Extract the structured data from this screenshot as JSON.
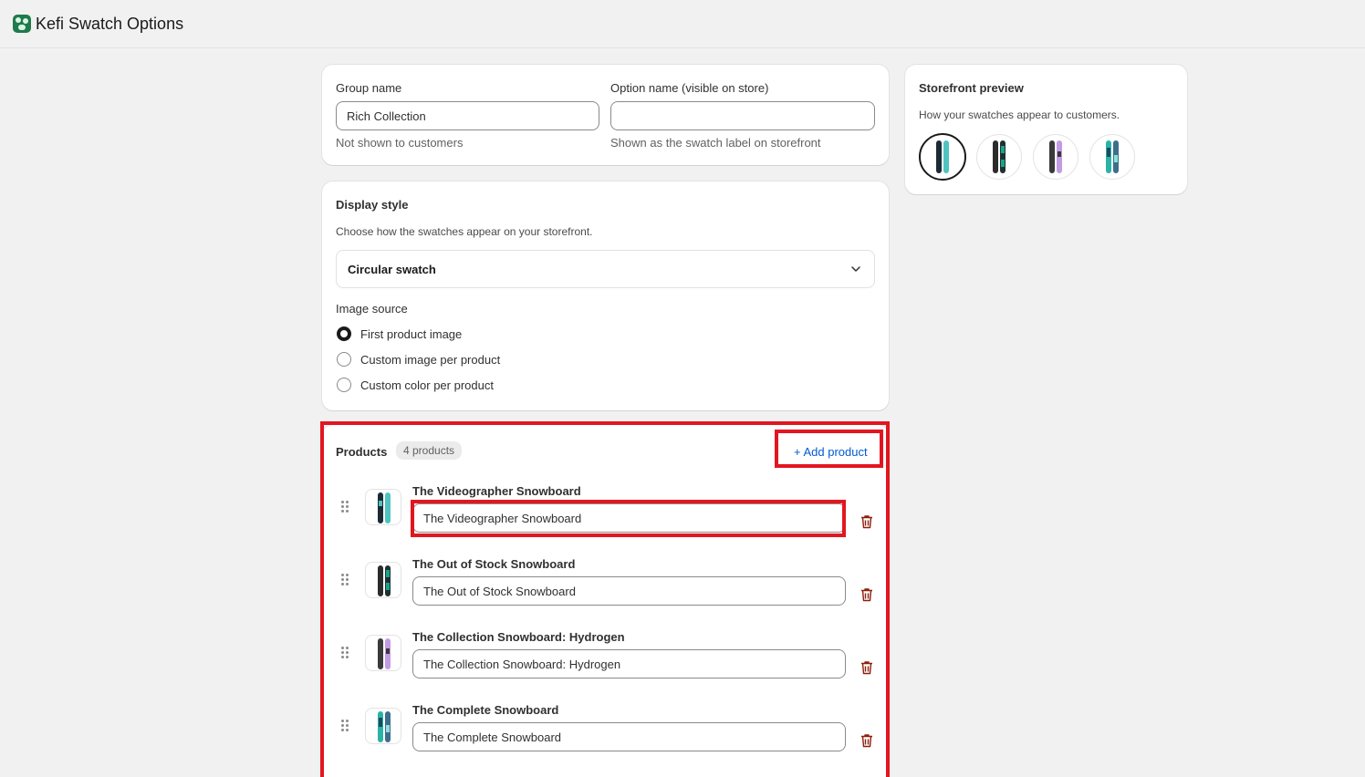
{
  "app": {
    "title": "Kefi Swatch Options"
  },
  "group": {
    "group_name_label": "Group name",
    "group_name_value": "Rich Collection",
    "group_name_help": "Not shown to customers",
    "option_name_label": "Option name (visible on store)",
    "option_name_value": "",
    "option_name_help": "Shown as the swatch label on storefront"
  },
  "display": {
    "title": "Display style",
    "description": "Choose how the swatches appear on your storefront.",
    "selected_style": "Circular swatch",
    "image_source_label": "Image source",
    "options": [
      {
        "label": "First product image",
        "checked": true
      },
      {
        "label": "Custom image per product",
        "checked": false
      },
      {
        "label": "Custom color per product",
        "checked": false
      }
    ]
  },
  "products": {
    "title": "Products",
    "count_badge": "4 products",
    "add_label": "+ Add product",
    "items": [
      {
        "name": "The Videographer Snowboard",
        "label_value": "The Videographer Snowboard",
        "colors": [
          "#1b2b35",
          "#4fc3c0"
        ]
      },
      {
        "name": "The Out of Stock Snowboard",
        "label_value": "The Out of Stock Snowboard",
        "colors": [
          "#2b2b2b",
          "#1aa38a"
        ]
      },
      {
        "name": "The Collection Snowboard: Hydrogen",
        "label_value": "The Collection Snowboard: Hydrogen",
        "colors": [
          "#3a3a3a",
          "#c39be3"
        ]
      },
      {
        "name": "The Complete Snowboard",
        "label_value": "The Complete Snowboard",
        "colors": [
          "#2ab3a6",
          "#3d6e8c"
        ]
      }
    ]
  },
  "preview": {
    "title": "Storefront preview",
    "description": "How your swatches appear to customers."
  },
  "colors": {
    "accent_link": "#005bd3",
    "trash": "#8e1f0b",
    "highlight": "#e3161f"
  }
}
